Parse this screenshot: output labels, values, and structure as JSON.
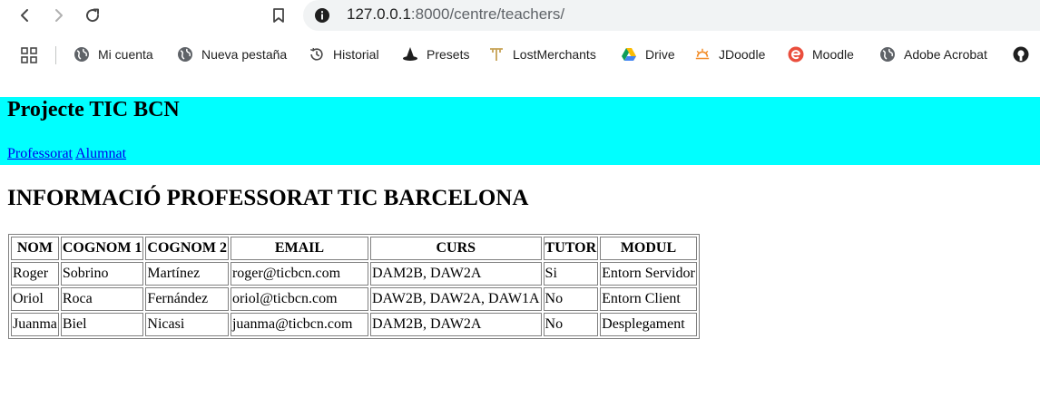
{
  "browser": {
    "url_host": "127.0.0.1",
    "url_path": ":8000/centre/teachers/",
    "bookmarks": [
      {
        "label": "Mi cuenta",
        "icon": "globe-icon"
      },
      {
        "label": "Nueva pestaña",
        "icon": "globe-icon"
      },
      {
        "label": "Historial",
        "icon": "history-icon"
      },
      {
        "label": "Presets",
        "icon": "witch-hat-icon"
      },
      {
        "label": "LostMerchants",
        "icon": "lostmerchants-icon"
      },
      {
        "label": "Drive",
        "icon": "drive-icon"
      },
      {
        "label": "JDoodle",
        "icon": "jdoodle-icon"
      },
      {
        "label": "Moodle",
        "icon": "moodle-icon"
      },
      {
        "label": "Adobe Acrobat",
        "icon": "globe-icon"
      },
      {
        "label": "",
        "icon": "github-icon"
      }
    ]
  },
  "site": {
    "title": "Projecte TIC BCN",
    "nav": [
      "Professorat",
      "Alumnat"
    ]
  },
  "main": {
    "heading": "INFORMACIÓ PROFESSORAT TIC BARCELONA",
    "table": {
      "headers": [
        "NOM",
        "COGNOM 1",
        "COGNOM 2",
        "EMAIL",
        "CURS",
        "TUTOR",
        "MODUL"
      ],
      "rows": [
        [
          "Roger",
          "Sobrino",
          "Martínez",
          "roger@ticbcn.com",
          "DAM2B, DAW2A",
          "Si",
          "Entorn Servidor"
        ],
        [
          "Oriol",
          "Roca",
          "Fernández",
          "oriol@ticbcn.com",
          "DAW2B, DAW2A, DAW1A",
          "No",
          "Entorn Client"
        ],
        [
          "Juanma",
          "Biel",
          "Nicasi",
          "juanma@ticbcn.com",
          "DAM2B, DAW2A",
          "No",
          "Desplegament"
        ]
      ]
    }
  }
}
